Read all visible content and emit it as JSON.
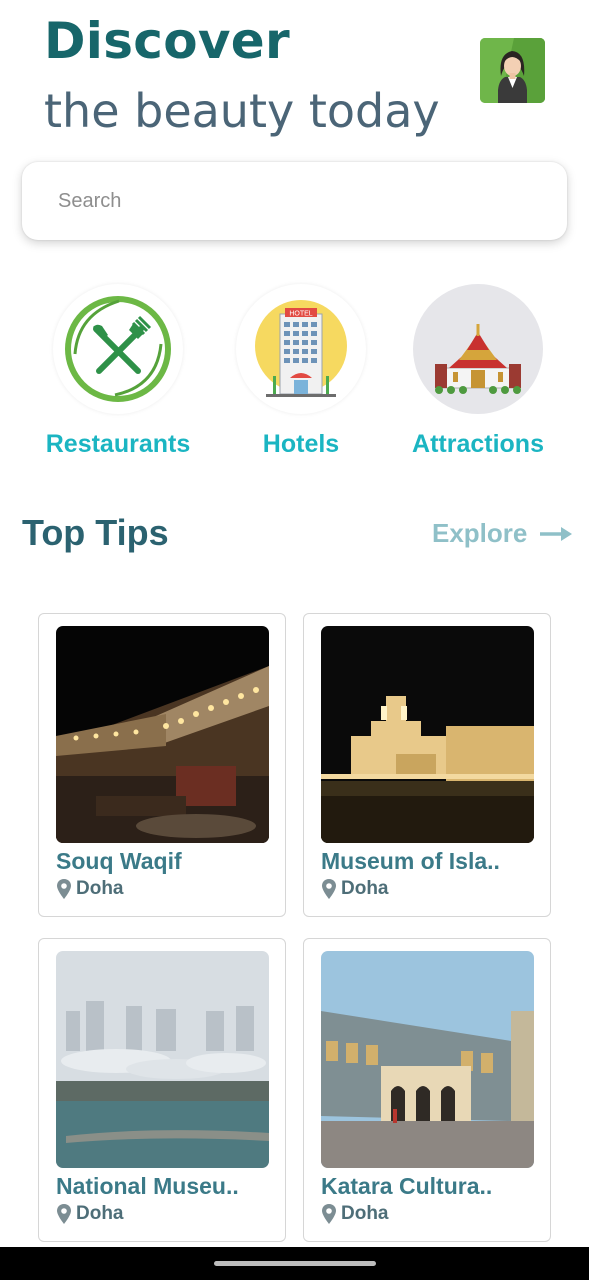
{
  "header": {
    "title": "Discover",
    "subtitle": "the beauty today",
    "avatar_icon": "user-avatar-icon"
  },
  "search": {
    "placeholder": "Search",
    "value": ""
  },
  "categories": [
    {
      "label": "Restaurants",
      "icon": "fork-knife-icon"
    },
    {
      "label": "Hotels",
      "icon": "hotel-icon"
    },
    {
      "label": "Attractions",
      "icon": "temple-icon"
    }
  ],
  "top_tips": {
    "title": "Top Tips",
    "explore_label": "Explore",
    "cards": [
      {
        "name": "Souq Waqif",
        "location": "Doha"
      },
      {
        "name": "Museum of Isla..",
        "location": "Doha"
      },
      {
        "name": "National Museu..",
        "location": "Doha"
      },
      {
        "name": "Katara Cultura..",
        "location": "Doha"
      }
    ]
  },
  "colors": {
    "title": "#17666a",
    "subtitle": "#4b6577",
    "accent": "#1bb5c2",
    "card_title": "#3b7a88"
  }
}
